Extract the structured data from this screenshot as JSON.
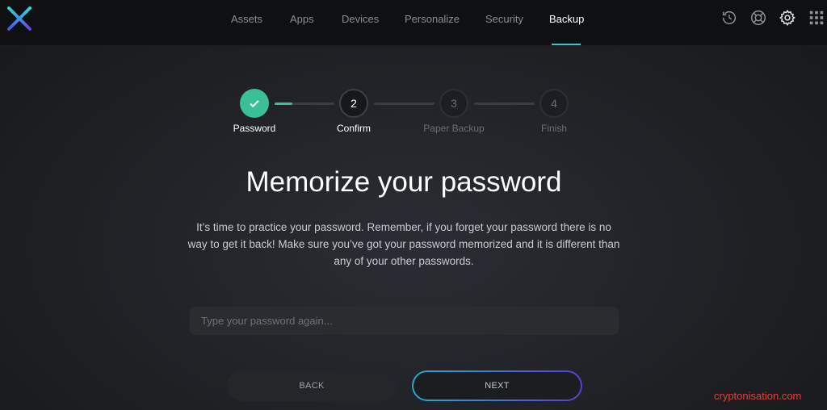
{
  "nav": {
    "items": [
      {
        "label": "Assets"
      },
      {
        "label": "Apps"
      },
      {
        "label": "Devices"
      },
      {
        "label": "Personalize"
      },
      {
        "label": "Security"
      },
      {
        "label": "Backup"
      }
    ],
    "active": "Backup"
  },
  "top_icons": [
    "history-icon",
    "lifebuoy-icon",
    "gear-icon",
    "grid-icon"
  ],
  "stepper": {
    "steps": [
      {
        "number": "",
        "label": "Password",
        "state": "done"
      },
      {
        "number": "2",
        "label": "Confirm",
        "state": "current"
      },
      {
        "number": "3",
        "label": "Paper Backup",
        "state": "todo"
      },
      {
        "number": "4",
        "label": "Finish",
        "state": "todo"
      }
    ],
    "first_connector_progress": 0.3
  },
  "heading": "Memorize your password",
  "description": "It’s time to practice your password. Remember, if you forget your password there is no way to get it back! Make sure you’ve got your password memorized and it is different than any of your other passwords.",
  "password_input": {
    "placeholder": "Type your password again...",
    "value": ""
  },
  "buttons": {
    "back": "BACK",
    "next": "NEXT"
  },
  "watermark": "cryptonisation.com",
  "colors": {
    "accent_green": "#3bbf95",
    "accent_teal": "#3ec7c0",
    "next_border_from": "#2aa9c8",
    "next_border_to": "#5b3fd6",
    "watermark": "#e2423d"
  }
}
